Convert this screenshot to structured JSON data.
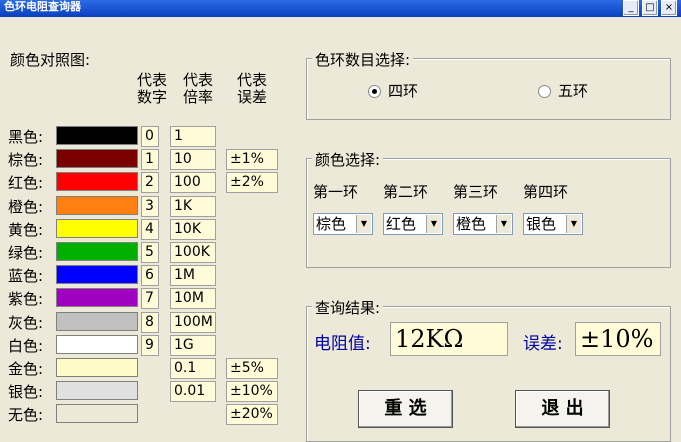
{
  "window": {
    "title": "色环电阻查询器",
    "min": "_",
    "max": "□",
    "close": "×"
  },
  "chart": {
    "title": "颜色对照图:",
    "headers": {
      "digit": "代表\n数字",
      "multiplier": "代表\n倍率",
      "tolerance": "代表\n误差"
    },
    "rows": [
      {
        "name": "黑色:",
        "color": "#000000",
        "digit": "0",
        "mult": "1",
        "tol": ""
      },
      {
        "name": "棕色:",
        "color": "#7a0000",
        "digit": "1",
        "mult": "10",
        "tol": "±1%"
      },
      {
        "name": "红色:",
        "color": "#ff0000",
        "digit": "2",
        "mult": "100",
        "tol": "±2%"
      },
      {
        "name": "橙色:",
        "color": "#ff7f10",
        "digit": "3",
        "mult": "1K",
        "tol": ""
      },
      {
        "name": "黄色:",
        "color": "#ffff00",
        "digit": "4",
        "mult": "10K",
        "tol": ""
      },
      {
        "name": "绿色:",
        "color": "#00b000",
        "digit": "5",
        "mult": "100K",
        "tol": ""
      },
      {
        "name": "蓝色:",
        "color": "#0000ff",
        "digit": "6",
        "mult": "1M",
        "tol": ""
      },
      {
        "name": "紫色:",
        "color": "#a000c0",
        "digit": "7",
        "mult": "10M",
        "tol": ""
      },
      {
        "name": "灰色:",
        "color": "#c0c0c0",
        "digit": "8",
        "mult": "100M",
        "tol": ""
      },
      {
        "name": "白色:",
        "color": "#ffffff",
        "digit": "9",
        "mult": "1G",
        "tol": ""
      },
      {
        "name": "金色:",
        "color": "#fffbc8",
        "digit": "",
        "mult": "0.1",
        "tol": "±5%"
      },
      {
        "name": "银色:",
        "color": "#e0e0e0",
        "digit": "",
        "mult": "0.01",
        "tol": "±10%"
      },
      {
        "name": "无色:",
        "color": "#ece9d8",
        "digit": "",
        "mult": "",
        "tol": "±20%"
      }
    ]
  },
  "bands": {
    "title": "色环数目选择:",
    "option4": "四环",
    "option5": "五环",
    "selected": "四环"
  },
  "colors": {
    "title": "颜色选择:",
    "labels": [
      "第一环",
      "第二环",
      "第三环",
      "第四环"
    ],
    "values": [
      "棕色",
      "红色",
      "橙色",
      "银色"
    ]
  },
  "result": {
    "title": "查询结果:",
    "resistance_label": "电阻值:",
    "resistance": "12KΩ",
    "tolerance_label": "误差:",
    "tolerance": "±10%"
  },
  "buttons": {
    "reset": "重  选",
    "exit": "退  出"
  }
}
